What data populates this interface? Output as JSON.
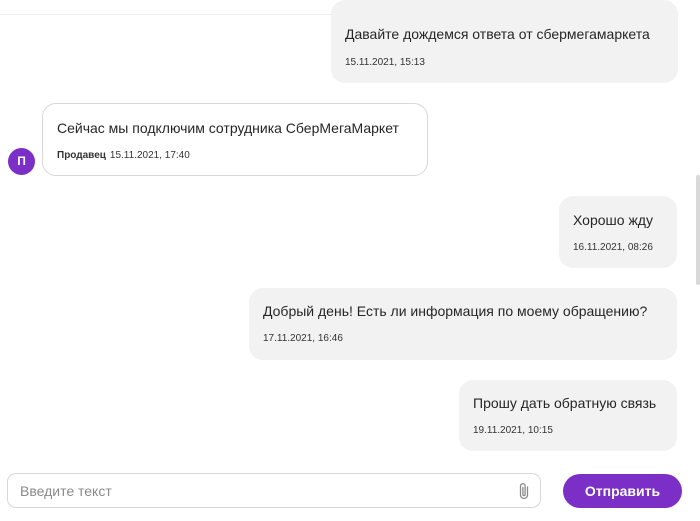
{
  "messages": [
    {
      "direction": "out",
      "text": "Давайте дождемся ответа от сбермегамаркета",
      "time": "15.11.2021, 15:13"
    },
    {
      "direction": "in",
      "sender": "Продавец",
      "avatar_letter": "П",
      "text": "Сейчас мы подключим сотрудника СберМегаМаркет",
      "time": "15.11.2021, 17:40"
    },
    {
      "direction": "out",
      "text": "Хорошо жду",
      "time": "16.11.2021, 08:26"
    },
    {
      "direction": "out",
      "text": "Добрый день! Есть ли информация по моему обращению?",
      "time": "17.11.2021, 16:46"
    },
    {
      "direction": "out",
      "text": "Прошу дать обратную связь",
      "time": "19.11.2021, 10:15"
    }
  ],
  "composer": {
    "placeholder": "Введите текст",
    "value": "",
    "attach_icon": "paperclip-icon",
    "send_label": "Отправить"
  },
  "colors": {
    "accent": "#7b2fc7",
    "outgoing_bubble": "#f2f2f3",
    "incoming_border": "#d7d7dc"
  }
}
